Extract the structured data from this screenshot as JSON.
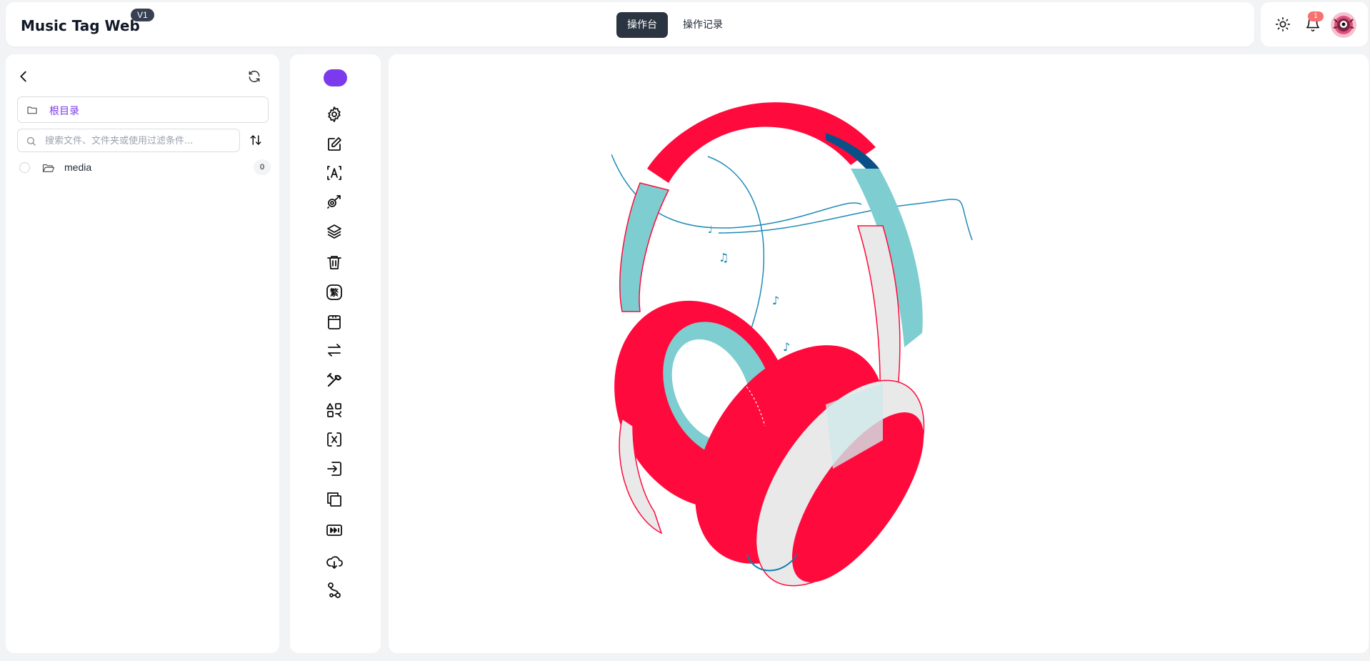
{
  "app": {
    "title": "Music Tag Web",
    "version": "V1"
  },
  "header": {
    "tabs": [
      {
        "label": "操作台",
        "active": true
      },
      {
        "label": "操作记录",
        "active": false
      }
    ],
    "notification_count": "1",
    "icons": [
      "sun-icon",
      "bell-icon",
      "avatar"
    ]
  },
  "file_panel": {
    "root_label": "根目录",
    "search": {
      "placeholder": "搜索文件、文件夹或使用过滤条件...",
      "value": ""
    },
    "items": [
      {
        "name": "media",
        "count": "0",
        "icon": "folder-open-icon"
      }
    ]
  },
  "toolbar": {
    "tools": [
      "settings-icon",
      "edit-icon",
      "text-recognize-icon",
      "music-fingerprint-icon",
      "layers-icon",
      "trash-icon",
      "traditional-chinese-icon",
      "archive-icon",
      "swap-icon",
      "wrench-icon",
      "shapes-transform-icon",
      "convert-icon",
      "import-icon",
      "copy-icon",
      "fast-forward-icon",
      "cloud-download-icon",
      "workflow-icon"
    ]
  },
  "colors": {
    "accent": "#7c3aed",
    "active_tab_bg": "#2b3441",
    "headphone_red": "#ff0a3c",
    "headphone_teal": "#7ecdd0",
    "headphone_blue": "#0e7fae",
    "background": "#f2f3f5"
  }
}
